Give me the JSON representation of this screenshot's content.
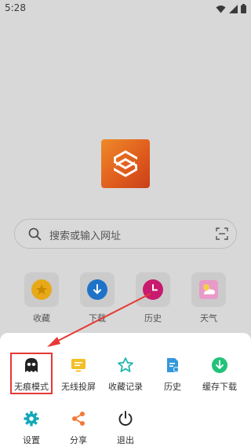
{
  "status_bar": {
    "time": "5:28"
  },
  "search": {
    "placeholder": "搜索或输入网址"
  },
  "quick_links": [
    {
      "label": "收藏",
      "icon": "star-icon",
      "color": "#f0b51a"
    },
    {
      "label": "下载",
      "icon": "download-icon",
      "color": "#1e7fd8"
    },
    {
      "label": "历史",
      "icon": "clock-icon",
      "color": "#d81b7b"
    },
    {
      "label": "天气",
      "icon": "weather-icon",
      "color": "#e58bc8"
    }
  ],
  "menu": {
    "items": [
      {
        "label": "无痕模式",
        "icon": "ghost-icon",
        "color": "#222222"
      },
      {
        "label": "无线投屏",
        "icon": "cast-icon",
        "color": "#f3bf26"
      },
      {
        "label": "收藏记录",
        "icon": "star-outline-icon",
        "color": "#22b8b0"
      },
      {
        "label": "历史",
        "icon": "history-doc-icon",
        "color": "#3498db"
      },
      {
        "label": "缓存下载",
        "icon": "download-circle-icon",
        "color": "#21c27a"
      },
      {
        "label": "设置",
        "icon": "gear-icon",
        "color": "#12a9b5"
      },
      {
        "label": "分享",
        "icon": "share-icon",
        "color": "#f07a3a"
      },
      {
        "label": "退出",
        "icon": "power-icon",
        "color": "#222222"
      }
    ]
  },
  "colors": {
    "highlight": "#e53935",
    "arrow": "#e53935",
    "logo": "#de5a1c"
  }
}
